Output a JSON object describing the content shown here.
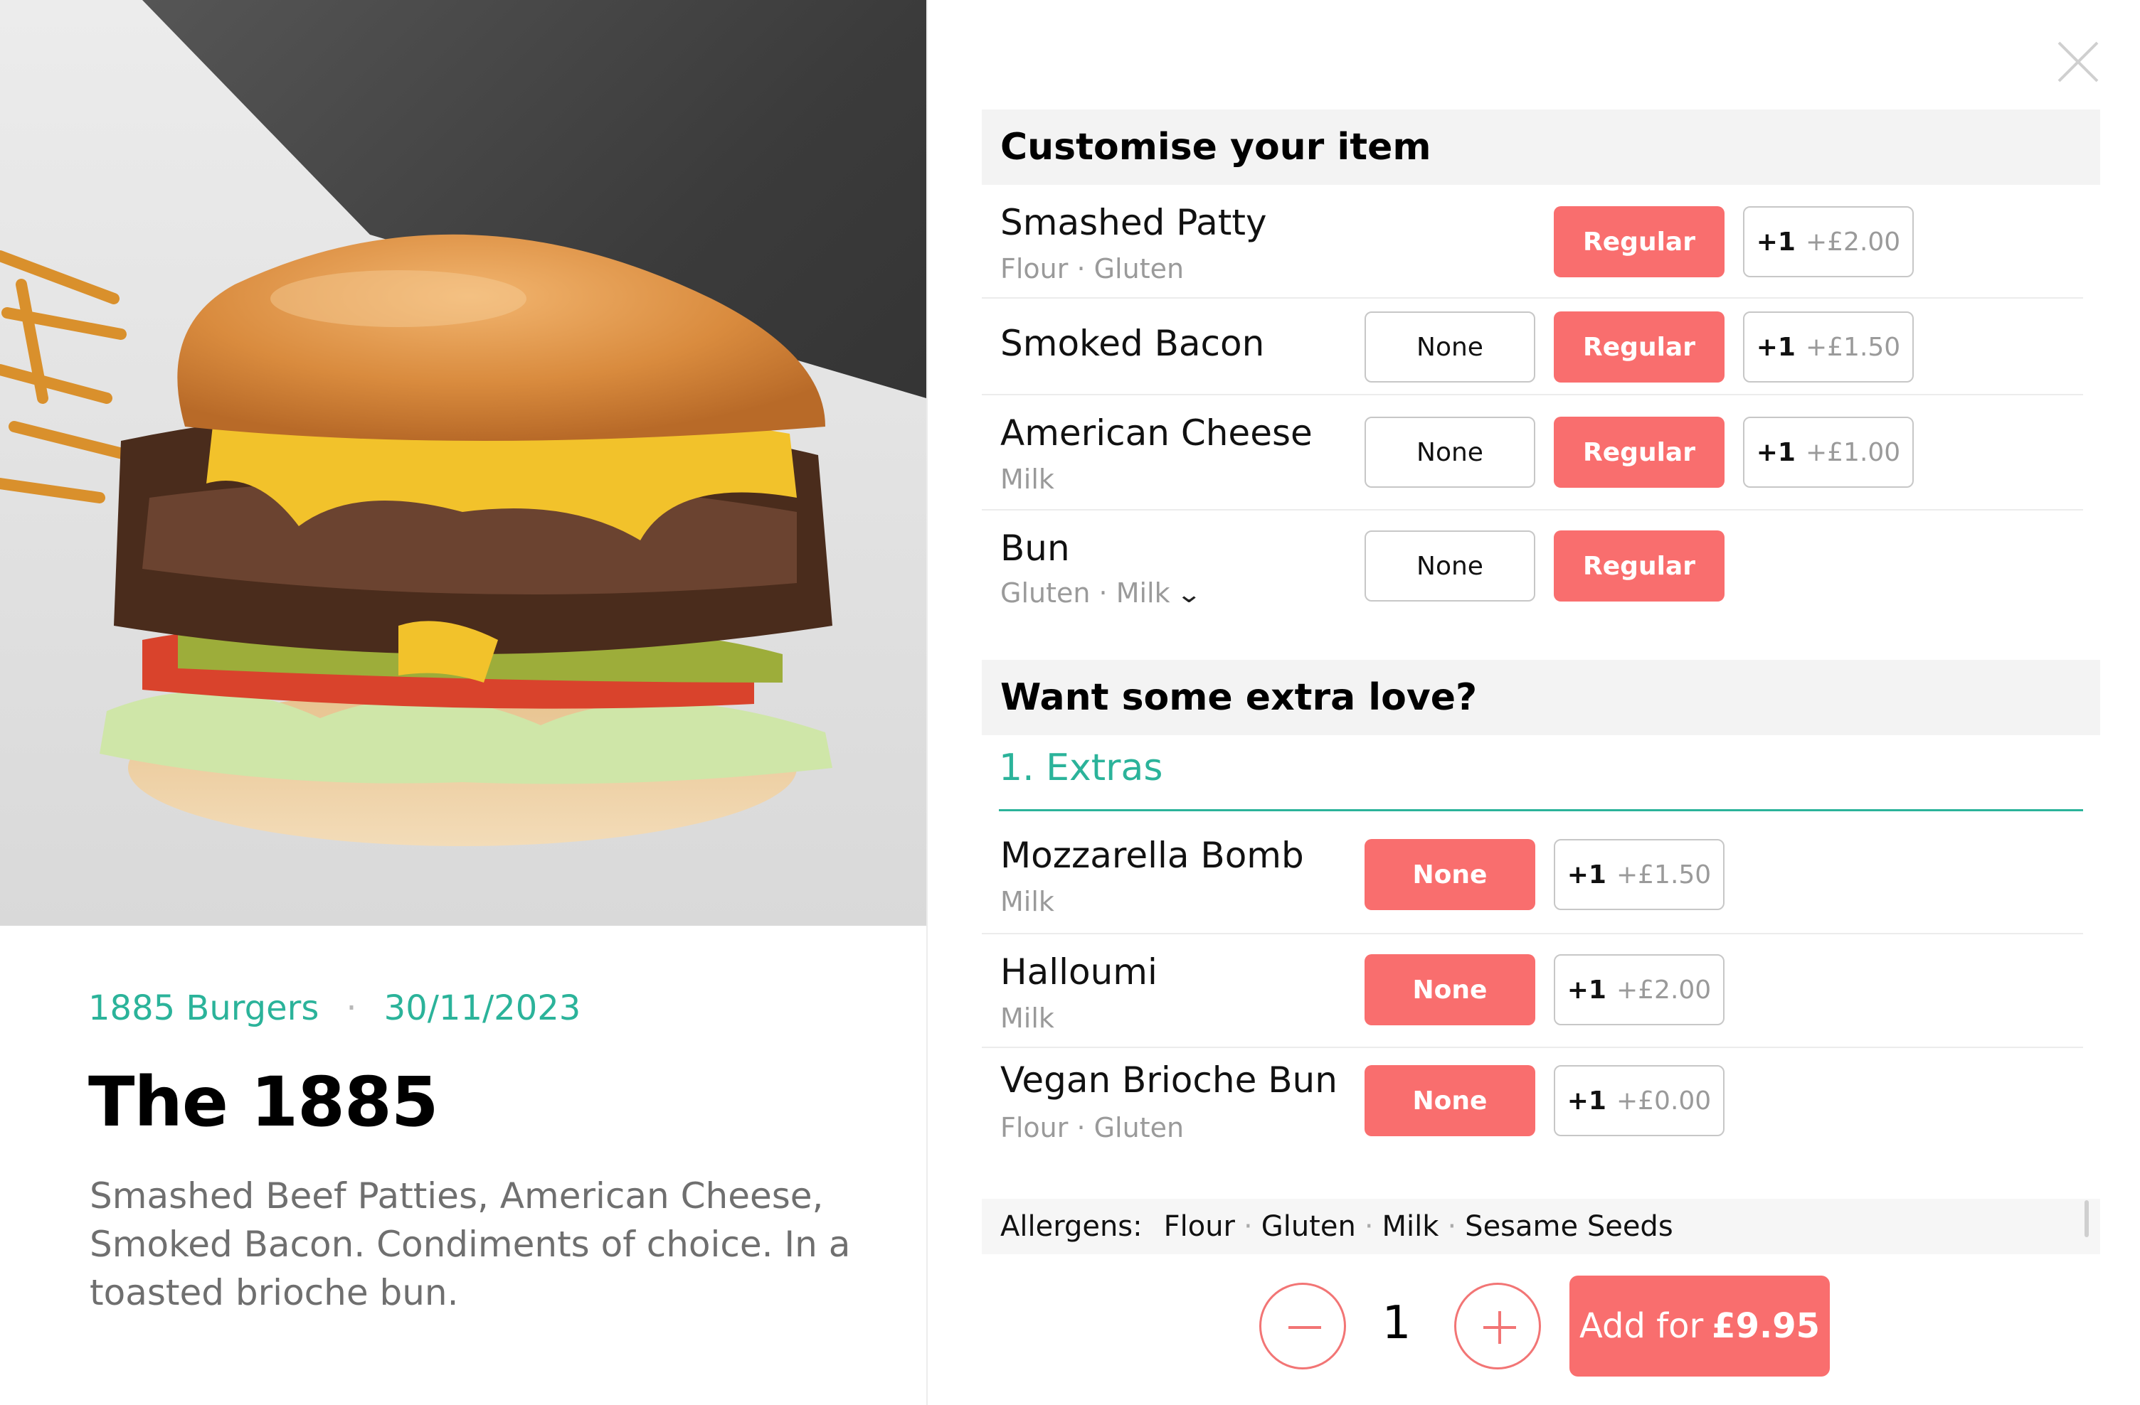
{
  "colors": {
    "accent_coral": "#f96e6e",
    "accent_teal": "#2bb39a",
    "muted_text": "#9a9a9a"
  },
  "item": {
    "restaurant": "1885 Burgers",
    "date": "30/11/2023",
    "title": "The 1885",
    "description": "Smashed Beef Patties, American Cheese, Smoked Bacon. Condiments of choice. In a toasted brioche bun."
  },
  "customise": {
    "header": "Customise your item",
    "rows": [
      {
        "name": "Smashed Patty",
        "allergens": "Flour · Gluten",
        "options": {
          "regular": "Regular",
          "plus": "+1",
          "price": "+£2.00"
        },
        "selected": "Regular"
      },
      {
        "name": "Smoked Bacon",
        "allergens": "",
        "options": {
          "none": "None",
          "regular": "Regular",
          "plus": "+1",
          "price": "+£1.50"
        },
        "selected": "Regular"
      },
      {
        "name": "American Cheese",
        "allergens": "Milk",
        "options": {
          "none": "None",
          "regular": "Regular",
          "plus": "+1",
          "price": "+£1.00"
        },
        "selected": "Regular"
      },
      {
        "name": "Bun",
        "allergens": "Gluten · Milk",
        "options": {
          "none": "None",
          "regular": "Regular"
        },
        "selected": "Regular",
        "expand_icon": "chevron-down-icon"
      }
    ]
  },
  "extras": {
    "header": "Want some extra love?",
    "group_title": "1. Extras",
    "rows": [
      {
        "name": "Mozzarella Bomb",
        "allergens": "Milk",
        "options": {
          "none": "None",
          "plus": "+1",
          "price": "+£1.50"
        },
        "selected": "None"
      },
      {
        "name": "Halloumi",
        "allergens": "Milk",
        "options": {
          "none": "None",
          "plus": "+1",
          "price": "+£2.00"
        },
        "selected": "None"
      },
      {
        "name": "Vegan Brioche Bun",
        "allergens": "Flour · Gluten",
        "options": {
          "none": "None",
          "plus": "+1",
          "price": "+£0.00"
        },
        "selected": "None"
      }
    ]
  },
  "allergens_bar": {
    "label": "Allergens:",
    "items": [
      "Flour",
      "Gluten",
      "Milk",
      "Sesame Seeds"
    ]
  },
  "footer": {
    "quantity": "1",
    "add_label": "Add for",
    "add_price": "£9.95",
    "decrement_icon": "minus-icon",
    "increment_icon": "plus-icon"
  },
  "close_icon": "close-icon"
}
